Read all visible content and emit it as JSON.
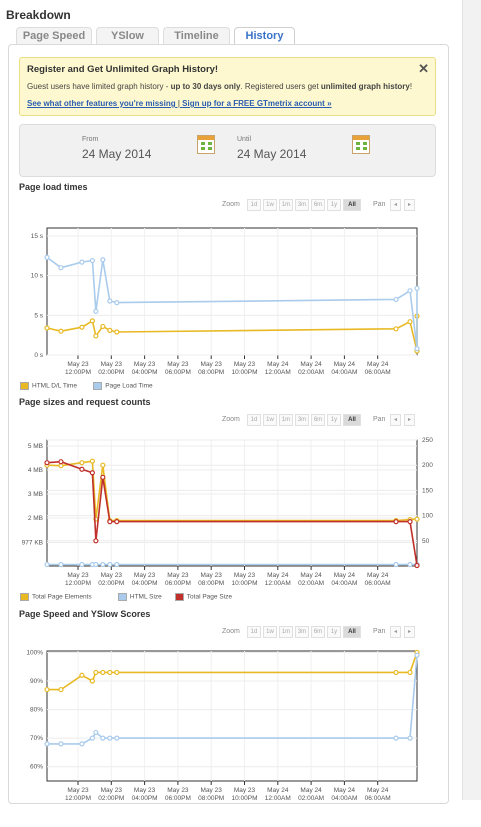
{
  "title": "Breakdown",
  "tabs": [
    {
      "label": "Page Speed"
    },
    {
      "label": "YSlow"
    },
    {
      "label": "Timeline"
    },
    {
      "label": "History",
      "active": true
    }
  ],
  "notice": {
    "heading": "Register and Get Unlimited Graph History!",
    "text_a": "Guest users have limited graph history - ",
    "text_b": "up to 30 days only",
    "text_c": ". Registered users get ",
    "text_d": "unlimited graph history",
    "text_e": "!",
    "link_a": "See what other features you're missing",
    "sep": " | ",
    "link_b": "Sign up for a FREE GTmetrix account »",
    "close": "✕"
  },
  "dates": {
    "from_label": "From",
    "from_value": "24 May 2014",
    "until_label": "Until",
    "until_value": "24 May 2014"
  },
  "zoom": {
    "label": "Zoom",
    "options": [
      "1d",
      "1w",
      "1m",
      "3m",
      "6m",
      "1y",
      "All"
    ],
    "selected": "All"
  },
  "pan": {
    "label": "Pan",
    "prev": "◂",
    "next": "▸"
  },
  "x_ticks": [
    "May 23\n12:00PM",
    "May 23\n02:00PM",
    "May 23\n04:00PM",
    "May 23\n06:00PM",
    "May 23\n08:00PM",
    "May 23\n10:00PM",
    "May 24\n12:00AM",
    "May 24\n02:00AM",
    "May 24\n04:00AM",
    "May 24\n06:00AM"
  ],
  "colors": {
    "yellow": "#e8b923",
    "blue": "#a9cbec",
    "red": "#c0302a"
  },
  "chart_data": [
    {
      "type": "line",
      "title": "Page load times",
      "y_ticks": [
        "0 s",
        "5 s",
        "10 s",
        "15 s"
      ],
      "ylim": [
        0,
        16
      ],
      "series": [
        {
          "name": "HTML D/L Time",
          "color": "#e8b923",
          "points": [
            [
              0,
              3.4
            ],
            [
              2,
              3.0
            ],
            [
              5,
              3.5
            ],
            [
              6.5,
              4.3
            ],
            [
              7,
              2.4
            ],
            [
              8,
              3.6
            ],
            [
              9,
              3.1
            ],
            [
              10,
              2.9
            ],
            [
              50,
              3.3
            ],
            [
              52,
              4.2
            ],
            [
              53,
              0.5
            ],
            [
              53,
              4.9
            ]
          ]
        },
        {
          "name": "Page Load Time",
          "color": "#a9cbec",
          "points": [
            [
              0,
              12.3
            ],
            [
              2,
              11.0
            ],
            [
              5,
              11.7
            ],
            [
              6.5,
              11.9
            ],
            [
              7,
              5.5
            ],
            [
              8,
              12.0
            ],
            [
              9,
              6.8
            ],
            [
              10,
              6.6
            ],
            [
              50,
              7.0
            ],
            [
              52,
              8.1
            ],
            [
              53,
              0.8
            ],
            [
              53,
              8.4
            ]
          ]
        }
      ]
    },
    {
      "type": "line",
      "title": "Page sizes and request counts",
      "y_ticks_left": [
        "977 KB",
        "2 MB",
        "3 MB",
        "4 MB",
        "5 MB"
      ],
      "y_ticks_right": [
        "50",
        "100",
        "150",
        "200",
        "250"
      ],
      "ylim_right": [
        0,
        250
      ],
      "series": [
        {
          "name": "Total Page Elements",
          "color": "#e8b923",
          "axis": "right",
          "points": [
            [
              0,
              200
            ],
            [
              2,
              199
            ],
            [
              5,
              205
            ],
            [
              6.5,
              208
            ],
            [
              7,
              93
            ],
            [
              8,
              200
            ],
            [
              9,
              90
            ],
            [
              10,
              90
            ],
            [
              50,
              90
            ],
            [
              52,
              92
            ],
            [
              53,
              93
            ]
          ]
        },
        {
          "name": "HTML Size",
          "color": "#a9cbec",
          "axis": "right",
          "points": [
            [
              0,
              3
            ],
            [
              2,
              3
            ],
            [
              5,
              3
            ],
            [
              6.5,
              3
            ],
            [
              7,
              3
            ],
            [
              8,
              3
            ],
            [
              9,
              3
            ],
            [
              10,
              3
            ],
            [
              50,
              3
            ],
            [
              52,
              3
            ],
            [
              53,
              3
            ]
          ]
        },
        {
          "name": "Total Page Size",
          "color": "#c0302a",
          "axis": "right",
          "points": [
            [
              0,
              205
            ],
            [
              2,
              207
            ],
            [
              5,
              192
            ],
            [
              6.5,
              185
            ],
            [
              7,
              50
            ],
            [
              8,
              176
            ],
            [
              9,
              88
            ],
            [
              10,
              88
            ],
            [
              50,
              88
            ],
            [
              52,
              88
            ],
            [
              53,
              1
            ]
          ]
        }
      ]
    },
    {
      "type": "line",
      "title": "Page Speed and YSlow Scores",
      "y_ticks": [
        "60%",
        "70%",
        "80%",
        "90%",
        "100%"
      ],
      "ylim": [
        55,
        100
      ],
      "series": [
        {
          "name": "Page Speed",
          "color": "#e8b923",
          "points": [
            [
              0,
              87
            ],
            [
              2,
              87
            ],
            [
              5,
              92
            ],
            [
              6.5,
              90
            ],
            [
              7,
              93
            ],
            [
              8,
              93
            ],
            [
              9,
              93
            ],
            [
              10,
              93
            ],
            [
              50,
              93
            ],
            [
              52,
              93
            ],
            [
              53,
              100
            ]
          ]
        },
        {
          "name": "YSlow",
          "color": "#a9cbec",
          "points": [
            [
              0,
              68
            ],
            [
              2,
              68
            ],
            [
              5,
              68
            ],
            [
              6.5,
              70
            ],
            [
              7,
              72
            ],
            [
              8,
              70
            ],
            [
              9,
              70
            ],
            [
              10,
              70
            ],
            [
              50,
              70
            ],
            [
              52,
              70
            ],
            [
              53,
              99
            ]
          ]
        }
      ]
    }
  ]
}
